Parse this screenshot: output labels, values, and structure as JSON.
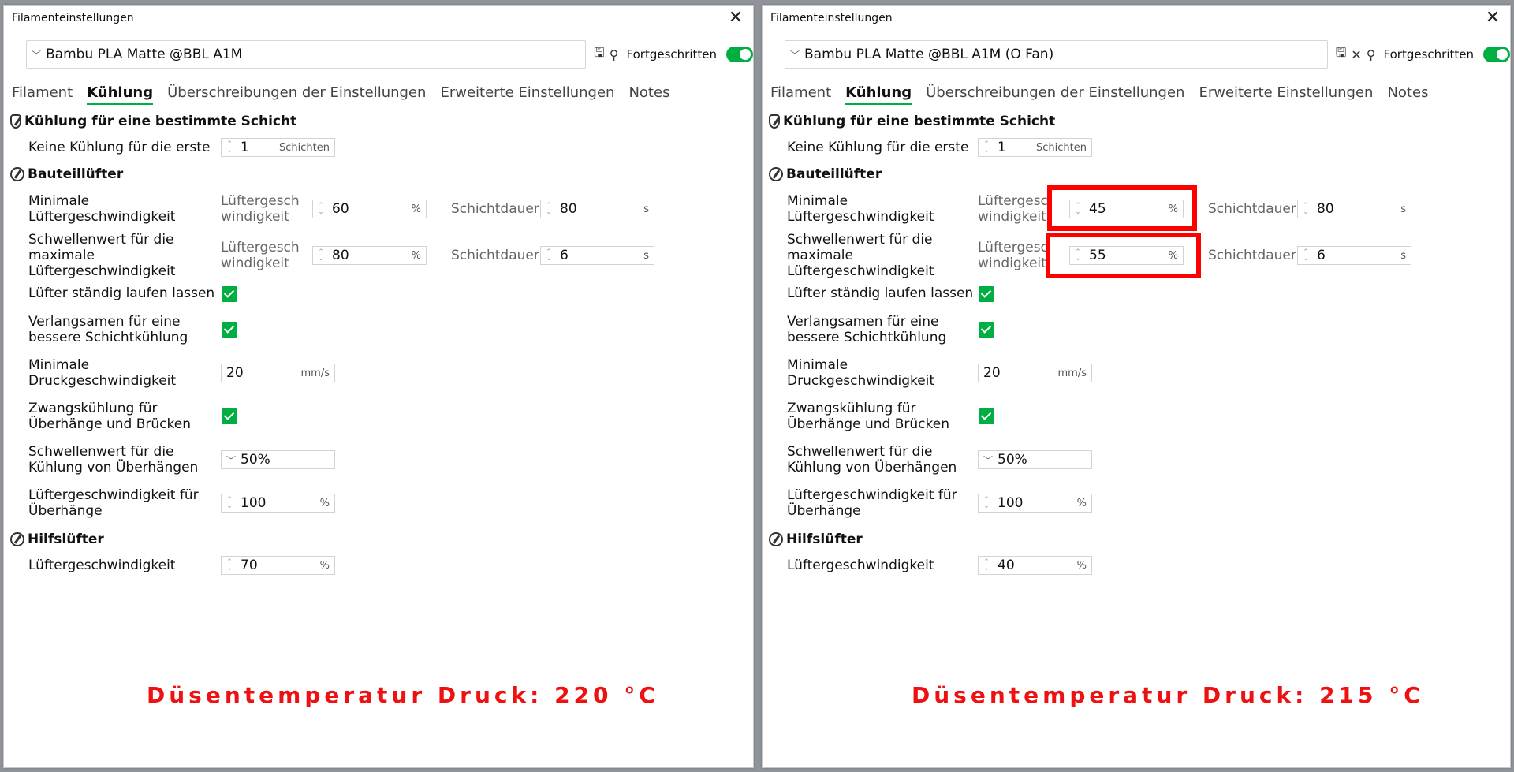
{
  "left": {
    "title": "Filamenteinstellungen",
    "close_glyph": "✕",
    "preset": "Bambu PLA Matte @BBL A1M",
    "advanced_label": "Fortgeschritten",
    "tabs": [
      "Filament",
      "Kühlung",
      "Überschreibungen der Einstellungen",
      "Erweiterte Einstellungen",
      "Notes"
    ],
    "sec_layer": "Kühlung für eine bestimmte Schicht",
    "no_cooling_label": "Keine Kühlung für die erste",
    "no_cooling_value": "1",
    "no_cooling_unit": "Schichten",
    "sec_part_fan": "Bauteillüfter",
    "min_fan_label_1": "Minimale",
    "min_fan_label_2": "Lüftergeschwindigkeit",
    "fan_sub_1": "Lüftergesch",
    "fan_sub_2": "windigkeit",
    "min_fan_value": "60",
    "pct": "%",
    "layer_time_label": "Schichtdauer",
    "min_layer_time": "80",
    "sec_unit": "s",
    "max_fan_label_1": "Schwellenwert für die",
    "max_fan_label_2": "maximale",
    "max_fan_label_3": "Lüftergeschwindigkeit",
    "max_fan_value": "80",
    "max_layer_time": "6",
    "keep_fan_label": "Lüfter ständig laufen lassen",
    "slow_label_1": "Verlangsamen für eine",
    "slow_label_2": "bessere Schichtkühlung",
    "min_speed_label_1": "Minimale",
    "min_speed_label_2": "Druckgeschwindigkeit",
    "min_speed_value": "20",
    "speed_unit": "mm/s",
    "force_label_1": "Zwangskühlung für",
    "force_label_2": "Überhänge und Brücken",
    "overhang_thr_label_1": "Schwellenwert für die",
    "overhang_thr_label_2": "Kühlung von Überhängen",
    "overhang_thr_value": "50%",
    "overhang_fan_label_1": "Lüftergeschwindigkeit für",
    "overhang_fan_label_2": "Überhänge",
    "overhang_fan_value": "100",
    "sec_aux": "Hilfslüfter",
    "aux_label": "Lüftergeschwindigkeit",
    "aux_value": "70",
    "caption": "Düsentemperatur Druck: 220 °C"
  },
  "right": {
    "title": "Filamenteinstellungen",
    "close_glyph": "✕",
    "preset": "Bambu PLA Matte @BBL A1M (O Fan)",
    "advanced_label": "Fortgeschritten",
    "tabs": [
      "Filament",
      "Kühlung",
      "Überschreibungen der Einstellungen",
      "Erweiterte Einstellungen",
      "Notes"
    ],
    "sec_layer": "Kühlung für eine bestimmte Schicht",
    "no_cooling_label": "Keine Kühlung für die erste",
    "no_cooling_value": "1",
    "no_cooling_unit": "Schichten",
    "sec_part_fan": "Bauteillüfter",
    "min_fan_label_1": "Minimale",
    "min_fan_label_2": "Lüftergeschwindigkeit",
    "fan_sub_1": "Lüftergesc",
    "fan_sub_2": "windigkeit",
    "min_fan_value": "45",
    "pct": "%",
    "layer_time_label": "Schichtdauer",
    "min_layer_time": "80",
    "sec_unit": "s",
    "max_fan_label_1": "Schwellenwert für die",
    "max_fan_label_2": "maximale",
    "max_fan_label_3": "Lüftergeschwindigkeit",
    "max_fan_value": "55",
    "max_layer_time": "6",
    "keep_fan_label": "Lüfter ständig laufen lassen",
    "slow_label_1": "Verlangsamen für eine",
    "slow_label_2": "bessere Schichtkühlung",
    "min_speed_label_1": "Minimale",
    "min_speed_label_2": "Druckgeschwindigkeit",
    "min_speed_value": "20",
    "speed_unit": "mm/s",
    "force_label_1": "Zwangskühlung für",
    "force_label_2": "Überhänge und Brücken",
    "overhang_thr_label_1": "Schwellenwert für die",
    "overhang_thr_label_2": "Kühlung von Überhängen",
    "overhang_thr_value": "50%",
    "overhang_fan_label_1": "Lüftergeschwindigkeit für",
    "overhang_fan_label_2": "Überhänge",
    "overhang_fan_value": "100",
    "sec_aux": "Hilfslüfter",
    "aux_label": "Lüftergeschwindigkeit",
    "aux_value": "40",
    "caption": "Düsentemperatur Druck: 215 °C"
  },
  "colors": {
    "accent": "#00ae42",
    "highlight": "#ff0000",
    "caption": "#ee1111"
  }
}
